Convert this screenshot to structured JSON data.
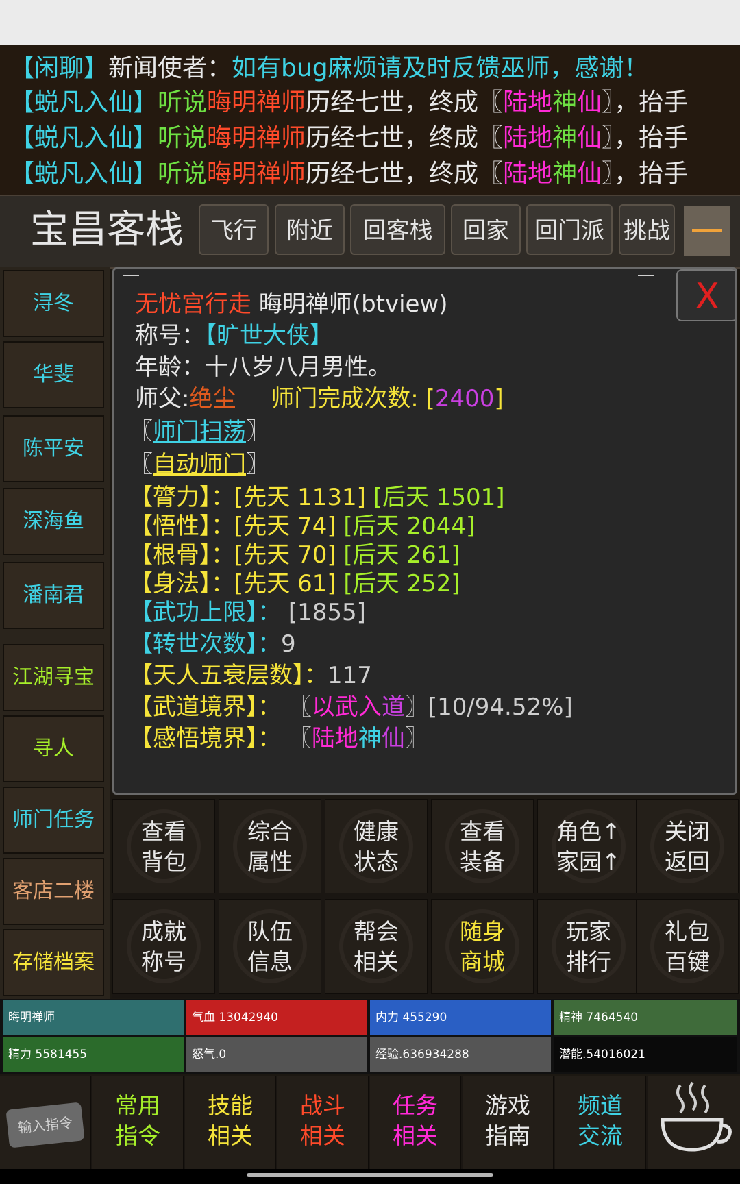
{
  "chat": [
    {
      "parts": [
        {
          "t": "【闲聊】",
          "c": "c-cyan"
        },
        {
          "t": "新闻使者：",
          "c": "c-white"
        },
        {
          "t": "如有bug麻烦请及时反馈巫师，感谢！",
          "c": "c-cyan"
        }
      ]
    },
    {
      "parts": [
        {
          "t": "【蜕凡入仙】",
          "c": "c-cyan"
        },
        {
          "t": "听说",
          "c": "c-green"
        },
        {
          "t": "晦明禅师",
          "c": "c-red"
        },
        {
          "t": "历经七世，终成〖",
          "c": "c-white"
        },
        {
          "t": "陆地",
          "c": "c-mag"
        },
        {
          "t": "神",
          "c": "c-green"
        },
        {
          "t": "仙",
          "c": "c-mag"
        },
        {
          "t": "〗，抬手",
          "c": "c-white"
        }
      ]
    },
    {
      "parts": [
        {
          "t": "【蜕凡入仙】",
          "c": "c-cyan"
        },
        {
          "t": "听说",
          "c": "c-green"
        },
        {
          "t": "晦明禅师",
          "c": "c-red"
        },
        {
          "t": "历经七世，终成〖",
          "c": "c-white"
        },
        {
          "t": "陆地",
          "c": "c-mag"
        },
        {
          "t": "神",
          "c": "c-green"
        },
        {
          "t": "仙",
          "c": "c-mag"
        },
        {
          "t": "〗，抬手",
          "c": "c-white"
        }
      ]
    },
    {
      "parts": [
        {
          "t": "【蜕凡入仙】",
          "c": "c-cyan"
        },
        {
          "t": "听说",
          "c": "c-green"
        },
        {
          "t": "晦明禅师",
          "c": "c-red"
        },
        {
          "t": "历经七世，终成〖",
          "c": "c-white"
        },
        {
          "t": "陆地",
          "c": "c-mag"
        },
        {
          "t": "神",
          "c": "c-green"
        },
        {
          "t": "仙",
          "c": "c-mag"
        },
        {
          "t": "〗，抬手",
          "c": "c-white"
        }
      ]
    }
  ],
  "location": {
    "title": "宝昌客栈",
    "buttons": [
      "飞行",
      "附近",
      "回客栈",
      "回家",
      "回门派",
      "挑战"
    ]
  },
  "sidebar": {
    "items": [
      {
        "label": "浔冬",
        "color": "c-cyan"
      },
      {
        "label": "华斐",
        "color": "c-cyan"
      },
      {
        "label": "陈平安",
        "color": "c-cyan"
      },
      {
        "label": "深海鱼",
        "color": "c-cyan"
      },
      {
        "label": "潘南君",
        "color": "c-cyan"
      },
      {
        "label": "江湖寻宝",
        "color": "c-lime"
      },
      {
        "label": "寻人",
        "color": "c-lime"
      },
      {
        "label": "师门任务",
        "color": "mixed"
      },
      {
        "label": "客店二楼",
        "color": "c-orange-light"
      },
      {
        "label": "存储档案",
        "color": "c-yellow"
      }
    ]
  },
  "panel": {
    "close": "X",
    "sect": "无忧宫行走",
    "name": "晦明禅师(btview)",
    "title_label": "称号：",
    "title_value": "【旷世大侠】",
    "age_label": "年龄：",
    "age_value": "十八岁八月男性。",
    "master_label": "师父:",
    "master_value": "绝尘",
    "sect_count_label": "师门完成次数: [",
    "sect_count_value": "2400",
    "sect_count_end": "]",
    "link1": "师门扫荡",
    "link2": "自动师门",
    "attributes": [
      {
        "label": "【膂力】：",
        "xt": "[先天 1131]",
        "ht": "[后天 1501]"
      },
      {
        "label": "【悟性】：",
        "xt": "[先天 74]",
        "ht": "[后天 2044]"
      },
      {
        "label": "【根骨】：",
        "xt": "[先天 70]",
        "ht": "[后天 261]"
      },
      {
        "label": "【身法】：",
        "xt": "[先天 61]",
        "ht": "[后天 252]"
      }
    ],
    "wugong_label": "【武功上限】：",
    "wugong_value": "[1855]",
    "zhuanshi_label": "【转世次数】：",
    "zhuanshi_value": "9",
    "tianren_label": "【天人五衰层数】：",
    "tianren_value": "117",
    "wudao_label": "【武道境界】：",
    "wudao_value_a": "以武入",
    "wudao_value_b": "道",
    "wudao_progress": "[10/94.52%]",
    "ganwu_label": "【感悟境界】：",
    "ganwu_value_a": "陆地",
    "ganwu_value_b": "神",
    "ganwu_value_c": "仙"
  },
  "grid": [
    {
      "l1": "查看",
      "l2": "背包",
      "color": "c-white"
    },
    {
      "l1": "综合",
      "l2": "属性",
      "color": "c-white"
    },
    {
      "l1": "健康",
      "l2": "状态",
      "color": "c-white"
    },
    {
      "l1": "查看",
      "l2": "装备",
      "color": "c-white"
    },
    {
      "l1": "角色↑",
      "l2": "家园↑",
      "color": "c-white"
    },
    {
      "l1": "关闭",
      "l2": "返回",
      "color": "c-white"
    },
    {
      "l1": "成就",
      "l2": "称号",
      "color": "c-white"
    },
    {
      "l1": "队伍",
      "l2": "信息",
      "color": "c-white"
    },
    {
      "l1": "帮会",
      "l2": "相关",
      "color": "c-white"
    },
    {
      "l1": "随身",
      "l2": "商城",
      "color": "c-yellow"
    },
    {
      "l1": "玩家",
      "l2": "排行",
      "color": "c-white"
    },
    {
      "l1": "礼包",
      "l2": "百键",
      "color": "c-white"
    }
  ],
  "stats": [
    {
      "label": "晦明禅师",
      "bg": "#2f6f6f"
    },
    {
      "label": "气血 13042940",
      "bg": "#c42020"
    },
    {
      "label": "内力 455290",
      "bg": "#2a5fc4"
    },
    {
      "label": "精神 7464540",
      "bg": "#3f6b3a"
    },
    {
      "label": "精力 5581455",
      "bg": "#2b6b2b"
    },
    {
      "label": "怒气.0",
      "bg": "#555555"
    },
    {
      "label": "经验.636934288",
      "bg": "#555555"
    },
    {
      "label": "潜能.54016021",
      "bg": "#0a0a0a"
    }
  ],
  "bottom": {
    "input_label": "输入指令",
    "buttons": [
      {
        "l1": "常用",
        "l2": "指令",
        "color": "c-lime"
      },
      {
        "l1": "技能",
        "l2": "相关",
        "color": "c-yellow"
      },
      {
        "l1": "战斗",
        "l2": "相关",
        "color": "c-red"
      },
      {
        "l1": "任务",
        "l2": "相关",
        "color": "c-mag"
      },
      {
        "l1": "游戏",
        "l2": "指南",
        "color": "c-white"
      },
      {
        "l1": "频道",
        "l2": "交流",
        "color": "c-cyan"
      }
    ]
  }
}
